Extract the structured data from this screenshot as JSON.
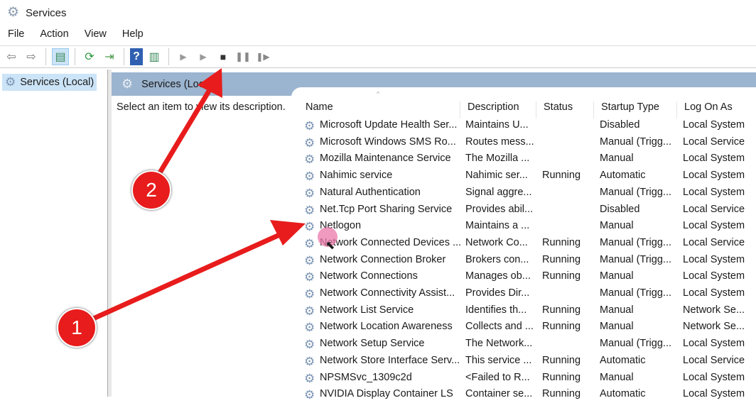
{
  "window": {
    "title": "Services"
  },
  "menu": [
    "File",
    "Action",
    "View",
    "Help"
  ],
  "tree": {
    "root": "Services (Local)"
  },
  "band": {
    "title": "Services (Local)"
  },
  "description_hint": "Select an item to view its description.",
  "columns": [
    "Name",
    "Description",
    "Status",
    "Startup Type",
    "Log On As"
  ],
  "rows": [
    [
      "Microsoft Update Health Ser...",
      "Maintains U...",
      "",
      "Disabled",
      "Local System"
    ],
    [
      "Microsoft Windows SMS Ro...",
      "Routes mess...",
      "",
      "Manual (Trigg...",
      "Local Service"
    ],
    [
      "Mozilla Maintenance Service",
      "The Mozilla ...",
      "",
      "Manual",
      "Local System"
    ],
    [
      "Nahimic service",
      "Nahimic ser...",
      "Running",
      "Automatic",
      "Local System"
    ],
    [
      "Natural Authentication",
      "Signal aggre...",
      "",
      "Manual (Trigg...",
      "Local System"
    ],
    [
      "Net.Tcp Port Sharing Service",
      "Provides abil...",
      "",
      "Disabled",
      "Local Service"
    ],
    [
      "Netlogon",
      "Maintains a ...",
      "",
      "Manual",
      "Local System"
    ],
    [
      "Network Connected Devices ...",
      "Network Co...",
      "Running",
      "Manual (Trigg...",
      "Local Service"
    ],
    [
      "Network Connection Broker",
      "Brokers con...",
      "Running",
      "Manual (Trigg...",
      "Local System"
    ],
    [
      "Network Connections",
      "Manages ob...",
      "Running",
      "Manual",
      "Local System"
    ],
    [
      "Network Connectivity Assist...",
      "Provides Dir...",
      "",
      "Manual (Trigg...",
      "Local System"
    ],
    [
      "Network List Service",
      "Identifies th...",
      "Running",
      "Manual",
      "Network Se..."
    ],
    [
      "Network Location Awareness",
      "Collects and ...",
      "Running",
      "Manual",
      "Network Se..."
    ],
    [
      "Network Setup Service",
      "The Network...",
      "",
      "Manual (Trigg...",
      "Local System"
    ],
    [
      "Network Store Interface Serv...",
      "This service ...",
      "Running",
      "Automatic",
      "Local Service"
    ],
    [
      "NPSMSvc_1309c2d",
      "<Failed to R...",
      "Running",
      "Manual",
      "Local System"
    ],
    [
      "NVIDIA Display Container LS",
      "Container se...",
      "Running",
      "Automatic",
      "Local System"
    ]
  ],
  "annotations": {
    "badge1": "1",
    "badge2": "2",
    "arrow_color": "#e81c1c"
  }
}
